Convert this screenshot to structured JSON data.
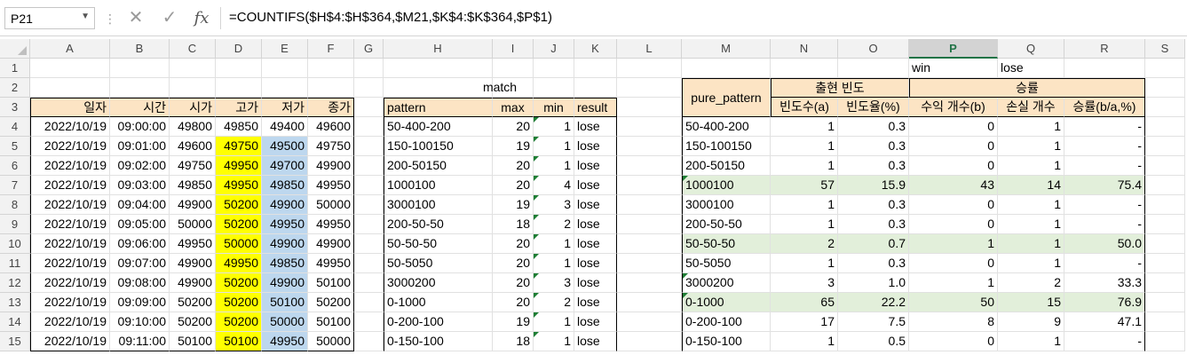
{
  "formula_bar": {
    "name_box": "P21",
    "cancel_icon": "✕",
    "enter_icon": "✓",
    "fx_label": "fx",
    "formula": "=COUNTIFS($H$4:$H$364,$M21,$K$4:$K$364,$P$1)"
  },
  "columns": [
    "A",
    "B",
    "C",
    "D",
    "E",
    "F",
    "G",
    "H",
    "I",
    "J",
    "K",
    "L",
    "M",
    "N",
    "O",
    "P",
    "Q",
    "R",
    "S"
  ],
  "selected_column": "P",
  "rows": [
    "1",
    "2",
    "3",
    "4",
    "5",
    "6",
    "7",
    "8",
    "9",
    "10",
    "11",
    "12",
    "13",
    "14",
    "15"
  ],
  "labels": {
    "win": "win",
    "lose": "lose",
    "match": "match",
    "pure_pattern": "pure_pattern",
    "freq_group": "출현 빈도",
    "winrate_group": "승률"
  },
  "price_table": {
    "headers": [
      "일자",
      "시간",
      "시가",
      "고가",
      "저가",
      "종가"
    ],
    "rows": [
      [
        "2022/10/19",
        "09:00:00",
        "49800",
        "49850",
        "49400",
        "49600"
      ],
      [
        "2022/10/19",
        "09:01:00",
        "49600",
        "49750",
        "49500",
        "49750"
      ],
      [
        "2022/10/19",
        "09:02:00",
        "49750",
        "49950",
        "49700",
        "49900"
      ],
      [
        "2022/10/19",
        "09:03:00",
        "49850",
        "49950",
        "49850",
        "49950"
      ],
      [
        "2022/10/19",
        "09:04:00",
        "49900",
        "50200",
        "49900",
        "50000"
      ],
      [
        "2022/10/19",
        "09:05:00",
        "50000",
        "50200",
        "49950",
        "49950"
      ],
      [
        "2022/10/19",
        "09:06:00",
        "49950",
        "50000",
        "49900",
        "49900"
      ],
      [
        "2022/10/19",
        "09:07:00",
        "49900",
        "49950",
        "49850",
        "49950"
      ],
      [
        "2022/10/19",
        "09:08:00",
        "49900",
        "50200",
        "49900",
        "50100"
      ],
      [
        "2022/10/19",
        "09:09:00",
        "50200",
        "50200",
        "50100",
        "50200"
      ],
      [
        "2022/10/19",
        "09:10:00",
        "50200",
        "50200",
        "50000",
        "50100"
      ],
      [
        "2022/10/19",
        "09:11:00",
        "50100",
        "50100",
        "49950",
        "50000"
      ]
    ]
  },
  "match_table": {
    "headers": [
      "pattern",
      "max",
      "min",
      "result"
    ],
    "rows": [
      [
        "50-400-200",
        "20",
        "1",
        "lose"
      ],
      [
        "150-100150",
        "19",
        "1",
        "lose"
      ],
      [
        "200-50150",
        "20",
        "1",
        "lose"
      ],
      [
        "1000100",
        "20",
        "4",
        "lose"
      ],
      [
        "3000100",
        "19",
        "3",
        "lose"
      ],
      [
        "200-50-50",
        "18",
        "2",
        "lose"
      ],
      [
        "50-50-50",
        "20",
        "1",
        "lose"
      ],
      [
        "50-5050",
        "20",
        "1",
        "lose"
      ],
      [
        "3000200",
        "20",
        "3",
        "lose"
      ],
      [
        "0-1000",
        "20",
        "2",
        "lose"
      ],
      [
        "0-200-100",
        "19",
        "1",
        "lose"
      ],
      [
        "0-150-100",
        "18",
        "1",
        "lose"
      ]
    ]
  },
  "stats_table": {
    "headers": [
      "빈도수(a)",
      "빈도율(%)",
      "수익 개수(b)",
      "손실 개수",
      "승률(b/a,%)"
    ],
    "rows": [
      [
        "50-400-200",
        "1",
        "0.3",
        "0",
        "1",
        "-"
      ],
      [
        "150-100150",
        "1",
        "0.3",
        "0",
        "1",
        "-"
      ],
      [
        "200-50150",
        "1",
        "0.3",
        "0",
        "1",
        "-"
      ],
      [
        "1000100",
        "57",
        "15.9",
        "43",
        "14",
        "75.4"
      ],
      [
        "3000100",
        "1",
        "0.3",
        "0",
        "1",
        "-"
      ],
      [
        "200-50-50",
        "1",
        "0.3",
        "0",
        "1",
        "-"
      ],
      [
        "50-50-50",
        "2",
        "0.7",
        "1",
        "1",
        "50.0"
      ],
      [
        "50-5050",
        "1",
        "0.3",
        "0",
        "1",
        "-"
      ],
      [
        "3000200",
        "3",
        "1.0",
        "1",
        "2",
        "33.3"
      ],
      [
        "0-1000",
        "65",
        "22.2",
        "50",
        "15",
        "76.9"
      ],
      [
        "0-200-100",
        "17",
        "7.5",
        "8",
        "9",
        "47.1"
      ],
      [
        "0-150-100",
        "1",
        "0.5",
        "0",
        "1",
        "-"
      ]
    ],
    "highlighted_rows": [
      3,
      6,
      9
    ]
  },
  "colors": {
    "header_fill": "#fce4c4",
    "high_fill": "#ffff00",
    "low_fill": "#bdd7ee",
    "highlight_row_fill": "#e2efda",
    "selected_header_text": "#217346"
  }
}
